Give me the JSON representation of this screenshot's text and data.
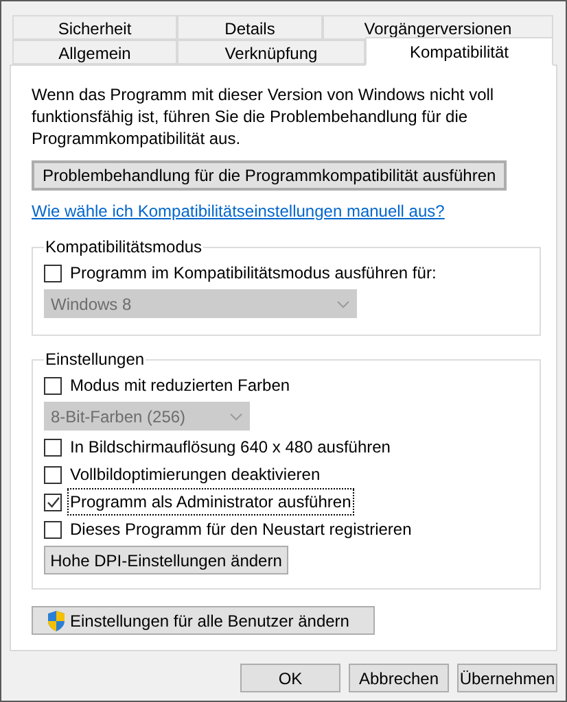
{
  "tab_rows": [
    [
      {
        "label": "Sicherheit",
        "selected": false
      },
      {
        "label": "Details",
        "selected": false
      },
      {
        "label": "Vorgängerversionen",
        "selected": false
      }
    ],
    [
      {
        "label": "Allgemein",
        "selected": false
      },
      {
        "label": "Verknüpfung",
        "selected": false
      },
      {
        "label": "Kompatibilität",
        "selected": true
      }
    ]
  ],
  "intro": "Wenn das Programm mit dieser Version von Windows nicht voll funktionsfähig ist, führen Sie die Problembehandlung für die Programmkompatibilität aus.",
  "troubleshoot_button": "Problembehandlung für die Programmkompatibilität ausführen",
  "help_link": "Wie wähle ich Kompatibilitätseinstellungen manuell aus?",
  "groups": [
    {
      "title": "Kompatibilitätsmodus",
      "items": [
        {
          "kind": "checkbox",
          "label": "Programm im Kompatibilitätsmodus ausführen für:",
          "checked": false,
          "focused": false
        },
        {
          "kind": "dropdown",
          "value": "Windows 8",
          "disabled": true,
          "wide": true
        }
      ]
    },
    {
      "title": "Einstellungen",
      "items": [
        {
          "kind": "checkbox",
          "label": "Modus mit reduzierten Farben",
          "checked": false,
          "focused": false
        },
        {
          "kind": "dropdown",
          "value": "8-Bit-Farben (256)",
          "disabled": true,
          "wide": false
        },
        {
          "kind": "checkbox",
          "label": "In Bildschirmauflösung 640 x 480 ausführen",
          "checked": false,
          "focused": false
        },
        {
          "kind": "checkbox",
          "label": "Vollbildoptimierungen deaktivieren",
          "checked": false,
          "focused": false
        },
        {
          "kind": "checkbox",
          "label": "Programm als Administrator ausführen",
          "checked": true,
          "focused": true
        },
        {
          "kind": "checkbox",
          "label": "Dieses Programm für den Neustart registrieren",
          "checked": false,
          "focused": false
        },
        {
          "kind": "button",
          "label": "Hohe DPI-Einstellungen ändern"
        }
      ]
    }
  ],
  "all_users_button": "Einstellungen für alle Benutzer ändern",
  "dialog_buttons": [
    {
      "label": "OK",
      "default": false
    },
    {
      "label": "Abbrechen",
      "default": false
    },
    {
      "label": "Übernehmen",
      "default": false
    }
  ]
}
